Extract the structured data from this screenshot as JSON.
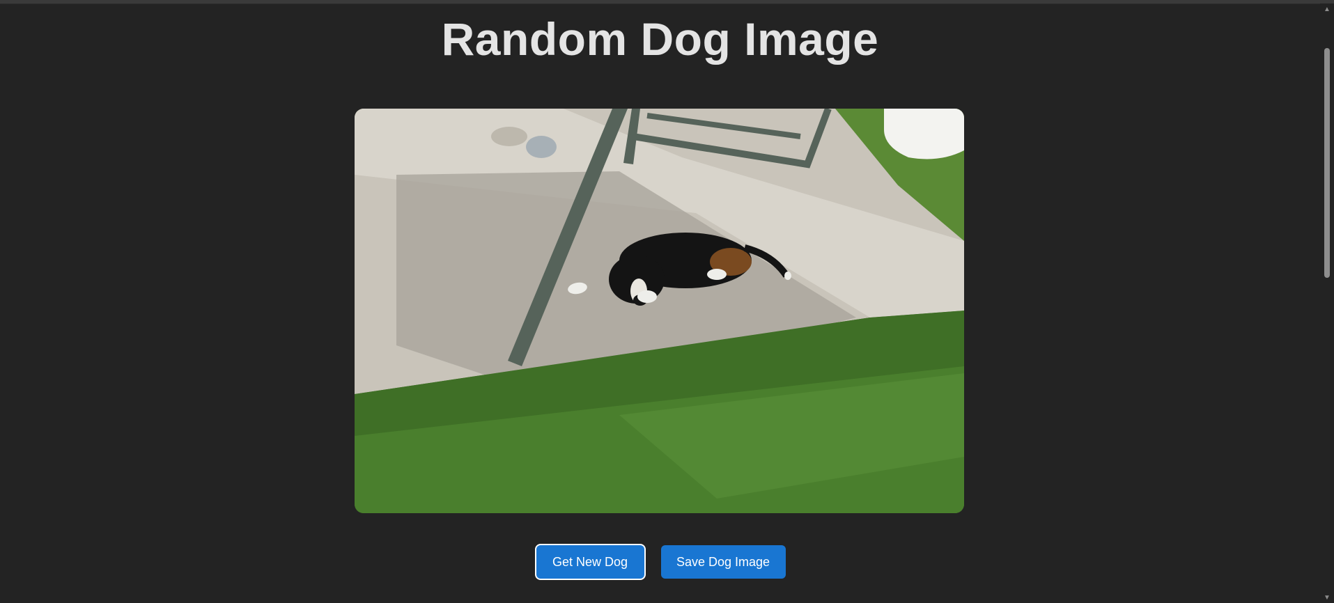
{
  "page": {
    "title": "Random Dog Image"
  },
  "image": {
    "alt": "dog lying in the shade on a concrete patio"
  },
  "buttons": {
    "new_dog": "Get New Dog",
    "save_dog": "Save Dog Image"
  },
  "scrollbar": {
    "up_glyph": "▲",
    "down_glyph": "▼"
  },
  "colors": {
    "background": "#232323",
    "title": "#e4e4e4",
    "button": "#1976d2",
    "button_text": "#ffffff"
  }
}
